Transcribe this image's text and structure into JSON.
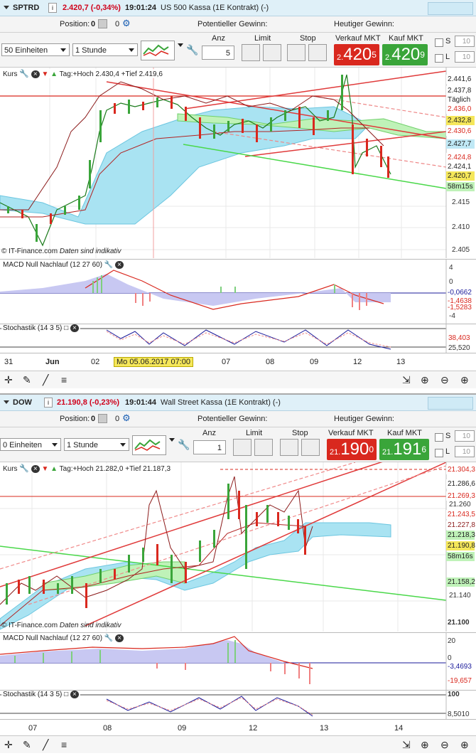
{
  "panels": [
    {
      "symbol": "SPTRD",
      "price_change": "2.420,7 (-0,34%)",
      "time": "19:01:24",
      "instrument": "US 500 Kassa (1E Kontrakt) (-)",
      "position_label": "Position:",
      "position_value": "0",
      "potential_label": "Potentieller Gewinn:",
      "today_label": "Heutiger Gewinn:",
      "units": "50 Einheiten",
      "interval": "1 Stunde",
      "anz_label": "Anz",
      "anz_value": "5",
      "limit_label": "Limit",
      "stop_label": "Stop",
      "sell_label": "Verkauf MKT",
      "buy_label": "Kauf MKT",
      "sell_prefix": "2.",
      "sell_main": "420",
      "sell_sup": "5",
      "buy_prefix": "2.",
      "buy_main": "420",
      "buy_sup": "9",
      "s_label": "S",
      "l_label": "L",
      "s_value": "10",
      "l_value": "10",
      "legend": "Tag:+Hoch 2.430,4 +Tief 2.419,6",
      "legend_name": "Kurs",
      "copyright": "© IT-Finance.com",
      "disclaimer": "Daten sind indikativ",
      "price_labels": [
        "2.441,6",
        "2.437,8",
        "Täglich",
        "2.436,0",
        "2.432,8",
        "2.430,6",
        "2.427,7",
        "2.424,8",
        "2.424,1",
        "2.420,7",
        "58m15s",
        "2.415",
        "2.410",
        "2.405"
      ],
      "macd_title": "MACD Null Nachlauf (12 27 60)",
      "macd_labels": [
        "4",
        "0",
        "-0,0662",
        "-1,4638",
        "-1,5283",
        "-4"
      ],
      "stoch_title": "Stochastik (14 3 5)",
      "stoch_labels": [
        "38,403",
        "25,520"
      ],
      "x_labels": [
        "31",
        "Jun",
        "02",
        "07",
        "08",
        "09",
        "12",
        "13"
      ],
      "x_tag": "Mo 05.06.2017 07:00"
    },
    {
      "symbol": "DOW",
      "price_change": "21.190,8 (-0,23%)",
      "time": "19:01:44",
      "instrument": "Wall Street Kassa (1E Kontrakt) (-)",
      "position_label": "Position:",
      "position_value": "0",
      "potential_label": "Potentieller Gewinn:",
      "today_label": "Heutiger Gewinn:",
      "units": "0 Einheiten",
      "interval": "1 Stunde",
      "anz_label": "Anz",
      "anz_value": "1",
      "limit_label": "Limit",
      "stop_label": "Stop",
      "sell_label": "Verkauf MKT",
      "buy_label": "Kauf MKT",
      "sell_prefix": "21.",
      "sell_main": "190",
      "sell_sup": "0",
      "buy_prefix": "21.",
      "buy_main": "191",
      "buy_sup": "6",
      "s_label": "S",
      "l_label": "L",
      "s_value": "10",
      "l_value": "10",
      "legend": "Tag:+Hoch 21.282,0 +Tief 21.187,3",
      "legend_name": "Kurs",
      "copyright": "© IT-Finance.com",
      "disclaimer": "Daten sind indikativ",
      "price_labels": [
        "21.304,3",
        "21.286,6",
        "21.269,3",
        "21.260",
        "21.243,5",
        "21.227,8",
        "21.218,3",
        "21.190,8",
        "58m16s",
        "21.158,2",
        "21.140",
        "21.100"
      ],
      "macd_title": "MACD Null Nachlauf (12 27 60)",
      "macd_labels": [
        "20",
        "0",
        "-3,4693",
        "-19,657"
      ],
      "stoch_title": "Stochastik (14 3 5)",
      "stoch_labels": [
        "100",
        "8,5010"
      ],
      "x_labels": [
        "07",
        "08",
        "09",
        "12",
        "13",
        "14"
      ],
      "x_tag": ""
    }
  ],
  "colors": {
    "sell": "#d9281e",
    "buy": "#3aa53a",
    "title_bg": "#dff0f8",
    "cloud": "#8fd9ee"
  }
}
